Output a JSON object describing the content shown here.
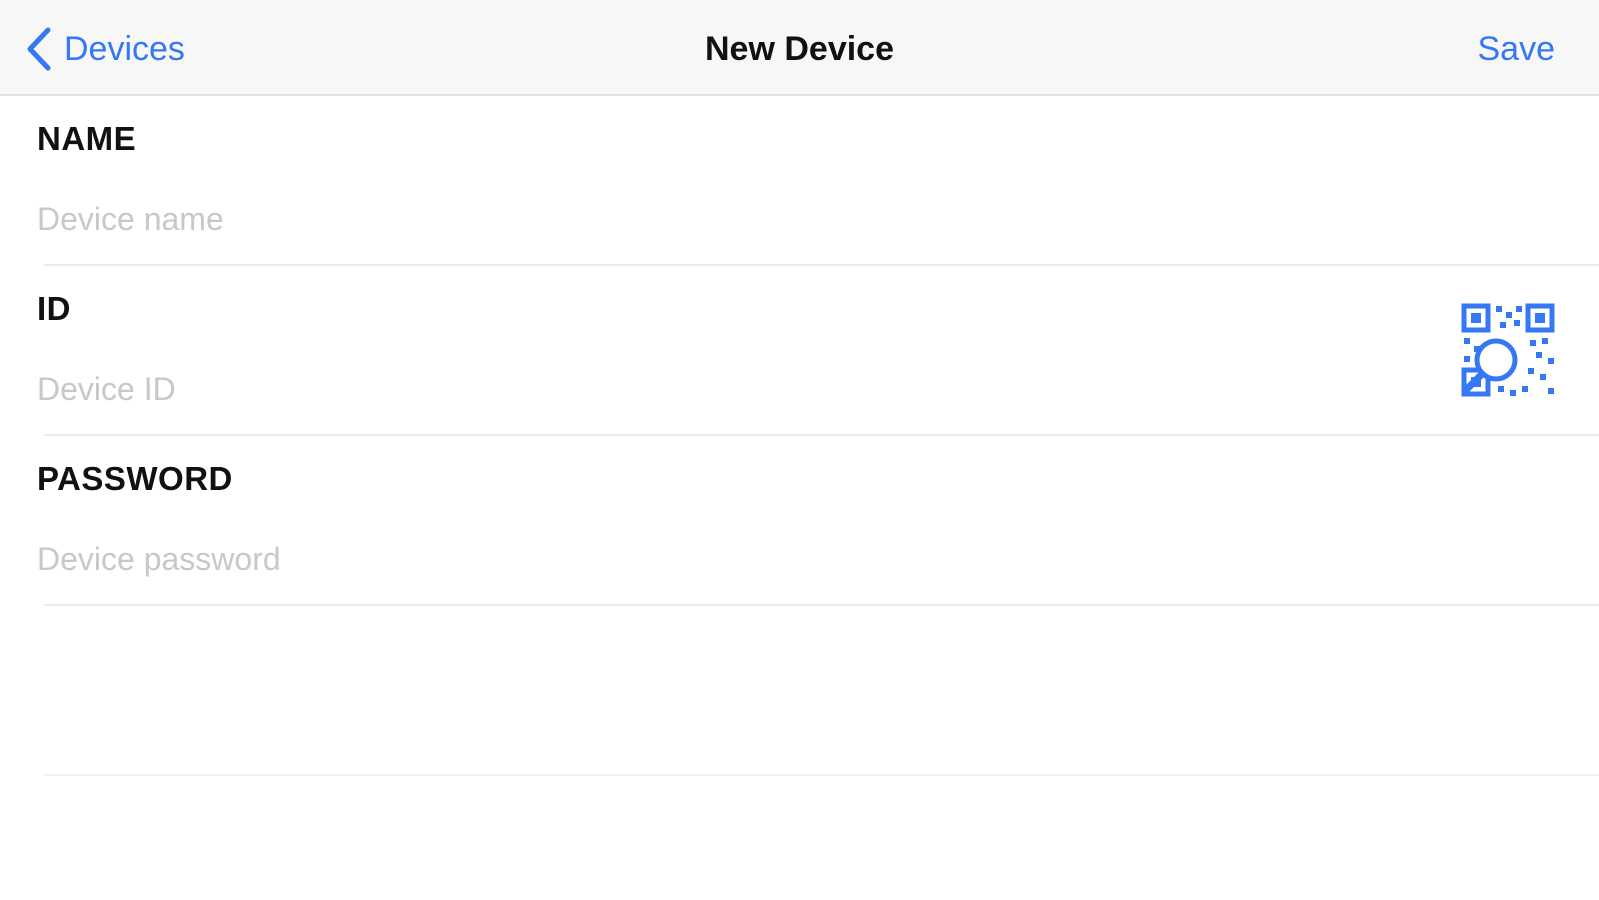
{
  "nav": {
    "back_label": "Devices",
    "title": "New Device",
    "save_label": "Save"
  },
  "form": {
    "name": {
      "label": "NAME",
      "placeholder": "Device name",
      "value": ""
    },
    "id": {
      "label": "ID",
      "placeholder": "Device ID",
      "value": "",
      "scan_icon": "qr-code-scan-icon"
    },
    "password": {
      "label": "PASSWORD",
      "placeholder": "Device password",
      "value": ""
    }
  },
  "colors": {
    "accent": "#3478f6",
    "navbar_bg": "#f7f7f7",
    "placeholder": "#c7c7cc",
    "separator": "#ececec"
  }
}
